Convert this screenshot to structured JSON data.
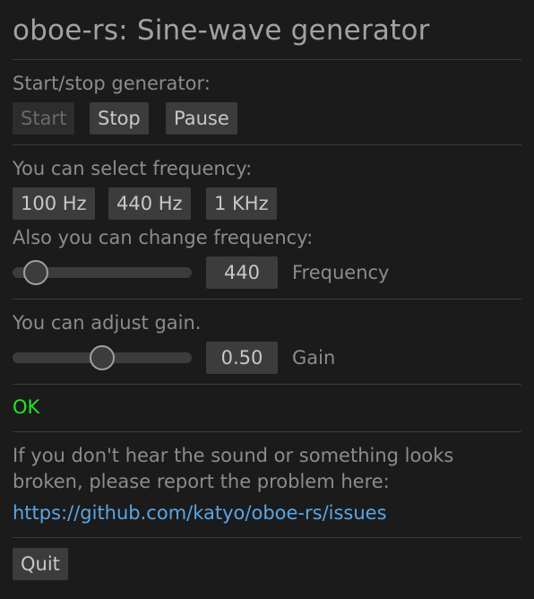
{
  "title": "oboe-rs: Sine-wave generator",
  "generator": {
    "label": "Start/stop generator:",
    "buttons": [
      {
        "label": "Start",
        "enabled": false
      },
      {
        "label": "Stop",
        "enabled": true
      },
      {
        "label": "Pause",
        "enabled": true
      }
    ]
  },
  "frequency_presets": {
    "label": "You can select frequency:",
    "buttons": [
      {
        "label": "100 Hz"
      },
      {
        "label": "440 Hz"
      },
      {
        "label": "1 KHz"
      }
    ]
  },
  "frequency_slider": {
    "label": "Also you can change frequency:",
    "value_text": "440",
    "value_label": "Frequency",
    "position": 0.13
  },
  "gain_slider": {
    "label": "You can adjust gain.",
    "value_text": "0.50",
    "value_label": "Gain",
    "position": 0.5
  },
  "status": {
    "text": "OK",
    "color": "#22e622"
  },
  "report": {
    "text": "If you don't hear the sound or something looks broken, please report the problem here:",
    "link": "https://github.com/katyo/oboe-rs/issues",
    "link_color": "#5aa6e6"
  },
  "quit_label": "Quit"
}
